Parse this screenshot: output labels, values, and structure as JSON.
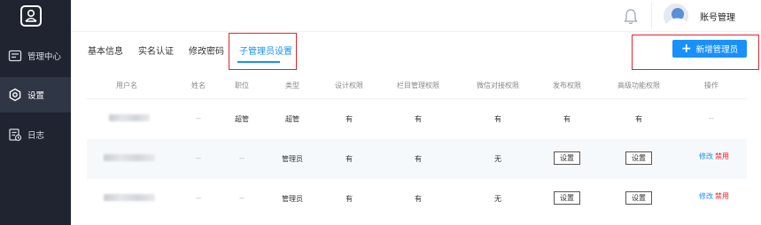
{
  "header": {
    "account_label": "账号管理"
  },
  "sidebar": {
    "items": [
      {
        "label": "管理中心",
        "icon": "dashboard-icon"
      },
      {
        "label": "设置",
        "icon": "settings-icon",
        "active": true
      },
      {
        "label": "日志",
        "icon": "log-icon"
      }
    ]
  },
  "tabs": [
    {
      "label": "基本信息"
    },
    {
      "label": "实名认证"
    },
    {
      "label": "修改密码"
    },
    {
      "label": "子管理员设置",
      "active": true
    }
  ],
  "actions": {
    "add_admin_label": "新增管理员"
  },
  "table": {
    "columns": [
      "用户名",
      "姓名",
      "职位",
      "类型",
      "设计权限",
      "栏目管理权限",
      "微信对接权限",
      "发布权限",
      "高级功能权限",
      "操作"
    ],
    "rows": [
      {
        "name": "--",
        "position": "超管",
        "type": "超管",
        "design": "有",
        "column": "有",
        "wechat": "有",
        "publish": "有",
        "advanced": "有",
        "ops": "--"
      },
      {
        "name": "--",
        "position": "--",
        "type": "管理员",
        "design": "有",
        "column": "有",
        "wechat": "无",
        "publish": "设置",
        "advanced": "设置",
        "edit": "修改",
        "ban": "禁用"
      },
      {
        "name": "--",
        "position": "--",
        "type": "管理员",
        "design": "有",
        "column": "有",
        "wechat": "无",
        "publish": "设置",
        "advanced": "设置",
        "edit": "修改",
        "ban": "禁用"
      }
    ]
  },
  "colors": {
    "sidebar_bg": "#1f2430",
    "accent": "#1890ff",
    "danger": "#e0262d"
  }
}
